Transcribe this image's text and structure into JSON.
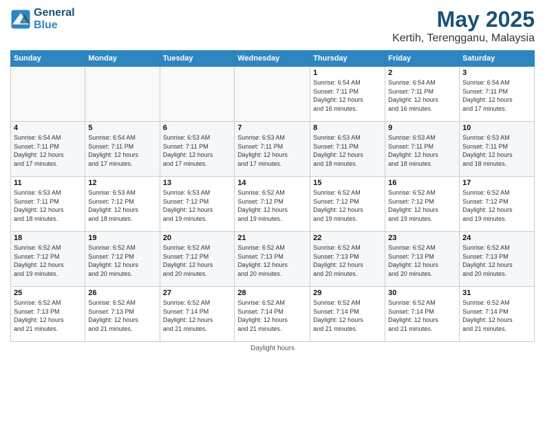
{
  "header": {
    "logo_line1": "General",
    "logo_line2": "Blue",
    "month": "May 2025",
    "location": "Kertih, Terengganu, Malaysia"
  },
  "days_of_week": [
    "Sunday",
    "Monday",
    "Tuesday",
    "Wednesday",
    "Thursday",
    "Friday",
    "Saturday"
  ],
  "weeks": [
    [
      {
        "day": "",
        "info": ""
      },
      {
        "day": "",
        "info": ""
      },
      {
        "day": "",
        "info": ""
      },
      {
        "day": "",
        "info": ""
      },
      {
        "day": "1",
        "info": "Sunrise: 6:54 AM\nSunset: 7:11 PM\nDaylight: 12 hours\nand 16 minutes."
      },
      {
        "day": "2",
        "info": "Sunrise: 6:54 AM\nSunset: 7:11 PM\nDaylight: 12 hours\nand 16 minutes."
      },
      {
        "day": "3",
        "info": "Sunrise: 6:54 AM\nSunset: 7:11 PM\nDaylight: 12 hours\nand 17 minutes."
      }
    ],
    [
      {
        "day": "4",
        "info": "Sunrise: 6:54 AM\nSunset: 7:11 PM\nDaylight: 12 hours\nand 17 minutes."
      },
      {
        "day": "5",
        "info": "Sunrise: 6:54 AM\nSunset: 7:11 PM\nDaylight: 12 hours\nand 17 minutes."
      },
      {
        "day": "6",
        "info": "Sunrise: 6:53 AM\nSunset: 7:11 PM\nDaylight: 12 hours\nand 17 minutes."
      },
      {
        "day": "7",
        "info": "Sunrise: 6:53 AM\nSunset: 7:11 PM\nDaylight: 12 hours\nand 17 minutes."
      },
      {
        "day": "8",
        "info": "Sunrise: 6:53 AM\nSunset: 7:11 PM\nDaylight: 12 hours\nand 18 minutes."
      },
      {
        "day": "9",
        "info": "Sunrise: 6:53 AM\nSunset: 7:11 PM\nDaylight: 12 hours\nand 18 minutes."
      },
      {
        "day": "10",
        "info": "Sunrise: 6:53 AM\nSunset: 7:11 PM\nDaylight: 12 hours\nand 18 minutes."
      }
    ],
    [
      {
        "day": "11",
        "info": "Sunrise: 6:53 AM\nSunset: 7:11 PM\nDaylight: 12 hours\nand 18 minutes."
      },
      {
        "day": "12",
        "info": "Sunrise: 6:53 AM\nSunset: 7:12 PM\nDaylight: 12 hours\nand 18 minutes."
      },
      {
        "day": "13",
        "info": "Sunrise: 6:53 AM\nSunset: 7:12 PM\nDaylight: 12 hours\nand 19 minutes."
      },
      {
        "day": "14",
        "info": "Sunrise: 6:52 AM\nSunset: 7:12 PM\nDaylight: 12 hours\nand 19 minutes."
      },
      {
        "day": "15",
        "info": "Sunrise: 6:52 AM\nSunset: 7:12 PM\nDaylight: 12 hours\nand 19 minutes."
      },
      {
        "day": "16",
        "info": "Sunrise: 6:52 AM\nSunset: 7:12 PM\nDaylight: 12 hours\nand 19 minutes."
      },
      {
        "day": "17",
        "info": "Sunrise: 6:52 AM\nSunset: 7:12 PM\nDaylight: 12 hours\nand 19 minutes."
      }
    ],
    [
      {
        "day": "18",
        "info": "Sunrise: 6:52 AM\nSunset: 7:12 PM\nDaylight: 12 hours\nand 19 minutes."
      },
      {
        "day": "19",
        "info": "Sunrise: 6:52 AM\nSunset: 7:12 PM\nDaylight: 12 hours\nand 20 minutes."
      },
      {
        "day": "20",
        "info": "Sunrise: 6:52 AM\nSunset: 7:12 PM\nDaylight: 12 hours\nand 20 minutes."
      },
      {
        "day": "21",
        "info": "Sunrise: 6:52 AM\nSunset: 7:13 PM\nDaylight: 12 hours\nand 20 minutes."
      },
      {
        "day": "22",
        "info": "Sunrise: 6:52 AM\nSunset: 7:13 PM\nDaylight: 12 hours\nand 20 minutes."
      },
      {
        "day": "23",
        "info": "Sunrise: 6:52 AM\nSunset: 7:13 PM\nDaylight: 12 hours\nand 20 minutes."
      },
      {
        "day": "24",
        "info": "Sunrise: 6:52 AM\nSunset: 7:13 PM\nDaylight: 12 hours\nand 20 minutes."
      }
    ],
    [
      {
        "day": "25",
        "info": "Sunrise: 6:52 AM\nSunset: 7:13 PM\nDaylight: 12 hours\nand 21 minutes."
      },
      {
        "day": "26",
        "info": "Sunrise: 6:52 AM\nSunset: 7:13 PM\nDaylight: 12 hours\nand 21 minutes."
      },
      {
        "day": "27",
        "info": "Sunrise: 6:52 AM\nSunset: 7:14 PM\nDaylight: 12 hours\nand 21 minutes."
      },
      {
        "day": "28",
        "info": "Sunrise: 6:52 AM\nSunset: 7:14 PM\nDaylight: 12 hours\nand 21 minutes."
      },
      {
        "day": "29",
        "info": "Sunrise: 6:52 AM\nSunset: 7:14 PM\nDaylight: 12 hours\nand 21 minutes."
      },
      {
        "day": "30",
        "info": "Sunrise: 6:52 AM\nSunset: 7:14 PM\nDaylight: 12 hours\nand 21 minutes."
      },
      {
        "day": "31",
        "info": "Sunrise: 6:52 AM\nSunset: 7:14 PM\nDaylight: 12 hours\nand 21 minutes."
      }
    ]
  ],
  "footer": "Daylight hours"
}
